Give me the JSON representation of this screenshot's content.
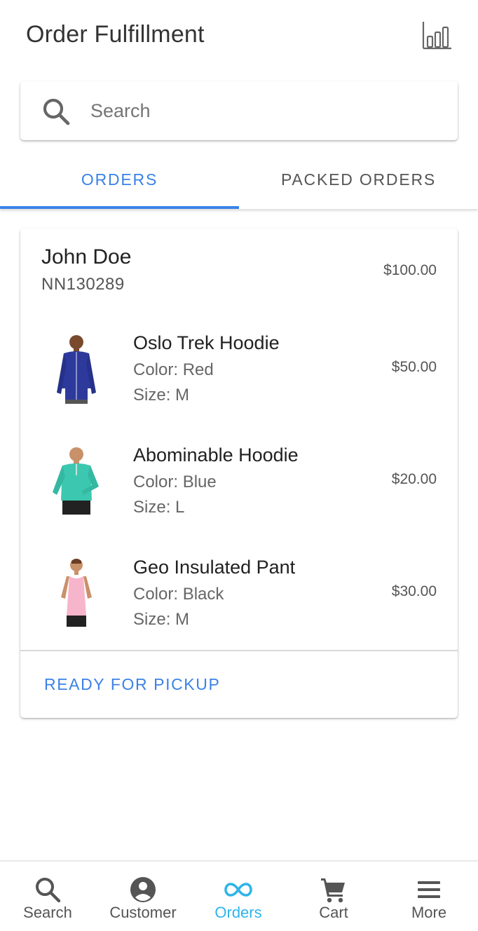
{
  "header": {
    "title": "Order Fulfillment",
    "analytics_icon": "bar-chart-icon"
  },
  "search": {
    "placeholder": "Search",
    "icon": "search-icon"
  },
  "tabs": [
    {
      "label": "ORDERS",
      "active": true
    },
    {
      "label": "PACKED ORDERS",
      "active": false
    }
  ],
  "order": {
    "customer_name": "John Doe",
    "order_id": "NN130289",
    "total": "$100.00",
    "items": [
      {
        "name": "Oslo Trek Hoodie",
        "color": "Color: Red",
        "size": "Size: M",
        "price": "$50.00",
        "thumb": "blue-hoodie-man"
      },
      {
        "name": "Abominable Hoodie",
        "color": "Color: Blue",
        "size": "Size: L",
        "price": "$20.00",
        "thumb": "teal-hoodie-man"
      },
      {
        "name": "Geo Insulated Pant",
        "color": "Color: Black",
        "size": "Size: M",
        "price": "$30.00",
        "thumb": "pink-tank-woman"
      }
    ],
    "action_label": "READY FOR PICKUP"
  },
  "bottom_nav": [
    {
      "label": "Search",
      "icon": "search-icon",
      "active": false
    },
    {
      "label": "Customer",
      "icon": "account-circle-icon",
      "active": false
    },
    {
      "label": "Orders",
      "icon": "infinity-icon",
      "active": true
    },
    {
      "label": "Cart",
      "icon": "cart-icon",
      "active": false
    },
    {
      "label": "More",
      "icon": "menu-icon",
      "active": false
    }
  ],
  "colors": {
    "accent": "#3b82e6",
    "nav_active": "#2fb4ea",
    "text": "#212121"
  }
}
